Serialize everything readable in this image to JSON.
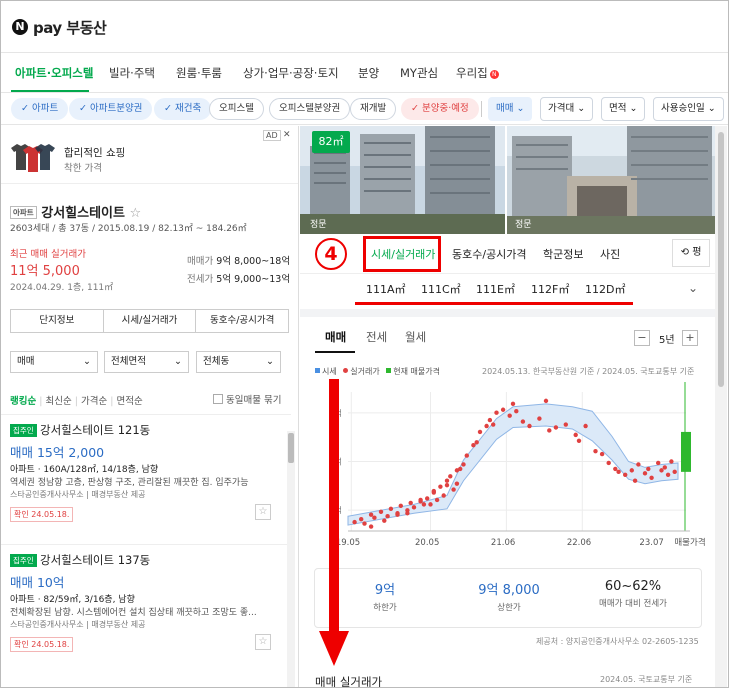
{
  "app": {
    "logo_letter": "N",
    "logo_text": "pay 부동산"
  },
  "main_nav": {
    "items": [
      "아파트·오피스텔",
      "빌라·주택",
      "원룸·투룸",
      "상가·업무·공장·토지",
      "분양",
      "MY관심",
      "우리집"
    ],
    "new_badge": "N"
  },
  "filters": {
    "chips": [
      "아파트",
      "아파트분양권",
      "재건축",
      "오피스텔",
      "오피스텔분양권",
      "재개발",
      "분양중·예정"
    ],
    "selects": [
      "매매",
      "가격대",
      "면적",
      "사용승인일"
    ]
  },
  "ad": {
    "tag": "AD",
    "close": "✕",
    "title": "합리적인 쇼핑",
    "subtitle": "착한 가격"
  },
  "complex": {
    "type_tag": "아파트",
    "name": "강서힐스테이트",
    "star": "☆",
    "meta": "2603세대 / 총 37동 / 2015.08.19 / 82.13㎡ ~ 184.26㎡",
    "recent_label": "최근 매매 실거래가",
    "recent_price": "11억 5,000",
    "recent_date": "2024.04.29. 1층, 111㎡",
    "sale_label": "매매가",
    "sale_range": "9억 8,000~18억",
    "jeonse_label": "전세가",
    "jeonse_range": "5억 9,000~13억",
    "buttons": [
      "단지정보",
      "시세/실거래가",
      "동호수/공시가격"
    ]
  },
  "list_filters": {
    "selects": [
      "매매",
      "전체면적",
      "전체동"
    ],
    "sorts": [
      "랭킹순",
      "최신순",
      "가격순",
      "면적순"
    ],
    "checkbox": "동일매물 묶기"
  },
  "listings": [
    {
      "tag": "집주인",
      "title": "강서힐스테이트 121동",
      "price": "매매 15억 2,000",
      "detail": "아파트 · 160A/128㎡, 14/18층, 남향",
      "desc": "역세권 정남향 고층, 판상형 구조, 관리잘된 깨끗한 집. 입주가능",
      "agent": "스타공인중개사사무소 | 매경부동산 제공",
      "confirm": "확인 24.05.18.",
      "star": "☆"
    },
    {
      "tag": "집주인",
      "title": "강서힐스테이트 137동",
      "price": "매매 10억",
      "detail": "아파트 · 82/59㎡, 3/16층, 남향",
      "desc": "전체확장된 남향. 시스템에어컨 설치 집상태 깨끗하고 조망도 좋...",
      "agent": "스타공인중개사사무소 | 매경부동산 제공",
      "confirm": "확인 24.05.18.",
      "star": "☆"
    }
  ],
  "photos": {
    "caption_left": "정문",
    "caption_right": "정문"
  },
  "detail_tabs": {
    "marker": "4",
    "items": [
      "시세/실거래가",
      "동호수/공시가격",
      "학군정보",
      "사진"
    ],
    "refresh": "평"
  },
  "areas": {
    "items": [
      "82㎡",
      "111A㎡",
      "111C㎡",
      "111E㎡",
      "112F㎡",
      "112D㎡"
    ],
    "chevron": "⌄"
  },
  "deal_tabs": {
    "items": [
      "매매",
      "전세",
      "월세"
    ],
    "period": "5년",
    "minus": "−",
    "plus": "+"
  },
  "legend": {
    "items": [
      "시세",
      "실거래가",
      "현재 매물가격"
    ],
    "colors": [
      "#4a90e2",
      "#e04141",
      "#2eb82e"
    ]
  },
  "source_note": "2024.05.13. 한국부동산원 기준 / 2024.05. 국토교통부 기준",
  "chart_data": {
    "type": "scatter",
    "x_ticks": [
      "19.05",
      "20.05",
      "21.06",
      "22.06",
      "23.07",
      "매물가격"
    ],
    "y_ticks": [
      "억",
      "억",
      "억"
    ],
    "band": {
      "x": [
        0,
        0.1,
        0.2,
        0.3,
        0.35,
        0.45,
        0.5,
        0.6,
        0.68,
        0.74,
        0.8,
        0.85,
        0.9,
        0.95,
        1.0
      ],
      "low": [
        8.2,
        8.6,
        9.0,
        9.3,
        11.2,
        14.0,
        14.8,
        14.9,
        14.7,
        13.9,
        12.6,
        11.3,
        11.0,
        11.2,
        11.3
      ],
      "high": [
        8.8,
        9.2,
        9.6,
        10.2,
        12.6,
        15.4,
        16.2,
        16.4,
        16.2,
        15.9,
        14.2,
        12.5,
        12.1,
        12.3,
        12.4
      ]
    },
    "points_x": [
      0.02,
      0.04,
      0.05,
      0.07,
      0.08,
      0.1,
      0.12,
      0.13,
      0.15,
      0.16,
      0.18,
      0.19,
      0.2,
      0.22,
      0.23,
      0.24,
      0.26,
      0.27,
      0.28,
      0.29,
      0.3,
      0.31,
      0.32,
      0.33,
      0.35,
      0.36,
      0.38,
      0.4,
      0.42,
      0.43,
      0.45,
      0.47,
      0.49,
      0.51,
      0.53,
      0.55,
      0.58,
      0.61,
      0.63,
      0.66,
      0.69,
      0.7,
      0.72,
      0.75,
      0.77,
      0.79,
      0.81,
      0.82,
      0.84,
      0.86,
      0.87,
      0.88,
      0.9,
      0.91,
      0.92,
      0.94,
      0.95,
      0.96,
      0.97,
      0.98,
      0.99,
      0.26,
      0.3,
      0.34,
      0.15,
      0.22,
      0.39,
      0.44,
      0.5,
      0.6,
      0.07,
      0.11,
      0.18,
      0.25,
      0.33
    ],
    "points_y": [
      8.4,
      8.6,
      8.3,
      8.9,
      8.7,
      9.1,
      8.8,
      9.3,
      9.0,
      9.5,
      9.2,
      9.7,
      9.4,
      9.8,
      9.6,
      10.0,
      10.4,
      9.9,
      10.8,
      10.2,
      10.9,
      11.5,
      10.6,
      11.9,
      12.3,
      12.9,
      13.6,
      14.5,
      14.9,
      15.3,
      15.8,
      16.0,
      15.6,
      15.9,
      15.2,
      14.9,
      15.4,
      14.6,
      14.8,
      15.0,
      14.3,
      13.9,
      14.9,
      13.2,
      13.0,
      12.4,
      12.0,
      11.8,
      11.6,
      11.9,
      11.2,
      12.3,
      11.7,
      12.0,
      11.4,
      12.4,
      11.9,
      12.1,
      11.6,
      12.5,
      11.8,
      10.5,
      11.2,
      12.0,
      8.9,
      9.9,
      13.8,
      15.0,
      16.4,
      16.6,
      8.1,
      8.5,
      9.0,
      9.6,
      11.0
    ],
    "listing_range": [
      11.8,
      14.5
    ],
    "ylim": [
      7.8,
      17.2
    ]
  },
  "stats": [
    {
      "value": "9억",
      "label": "하한가"
    },
    {
      "value": "9억 8,000",
      "label": "상한가"
    },
    {
      "value": "60~62%",
      "label": "매매가 대비 전세가"
    }
  ],
  "provider_note": "제공처 : 양지공인중개사사무소 02-2605-1235",
  "bottom": {
    "title": "매매 실거래가",
    "date": "2024.05. 국토교통부 기준"
  }
}
